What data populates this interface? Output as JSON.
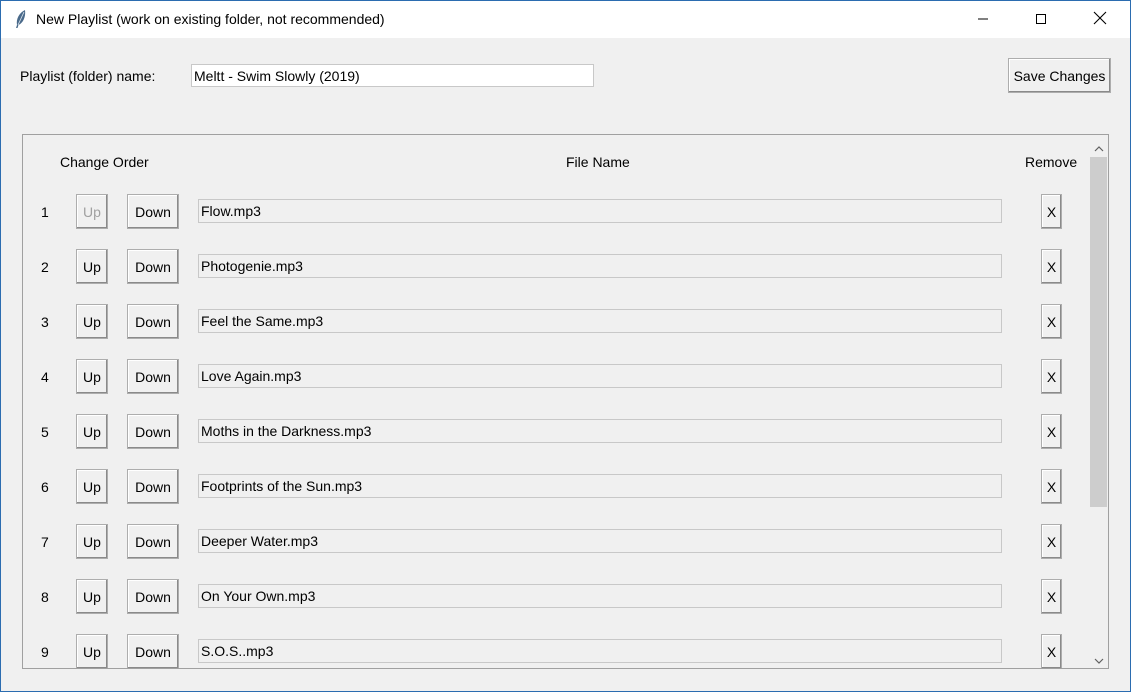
{
  "window": {
    "title": "New Playlist (work on existing folder, not recommended)",
    "icon": "feather-icon",
    "controls": [
      "minimize-icon",
      "maximize-icon",
      "close-icon"
    ]
  },
  "form": {
    "name_label": "Playlist (folder) name:",
    "name_value": "Meltt - Swim Slowly (2019)",
    "save_label": "Save Changes"
  },
  "list": {
    "headers": {
      "order": "Change Order",
      "file": "File Name",
      "remove": "Remove"
    },
    "up_label": "Up",
    "down_label": "Down",
    "remove_label": "X",
    "rows": [
      {
        "num": "1",
        "file": "Flow.mp3",
        "up_disabled": true
      },
      {
        "num": "2",
        "file": "Photogenie.mp3",
        "up_disabled": false
      },
      {
        "num": "3",
        "file": "Feel the Same.mp3",
        "up_disabled": false
      },
      {
        "num": "4",
        "file": "Love Again.mp3",
        "up_disabled": false
      },
      {
        "num": "5",
        "file": "Moths in the Darkness.mp3",
        "up_disabled": false
      },
      {
        "num": "6",
        "file": "Footprints of the Sun.mp3",
        "up_disabled": false
      },
      {
        "num": "7",
        "file": "Deeper Water.mp3",
        "up_disabled": false
      },
      {
        "num": "8",
        "file": "On Your Own.mp3",
        "up_disabled": false
      },
      {
        "num": "9",
        "file": "S.O.S..mp3",
        "up_disabled": false
      }
    ]
  },
  "colors": {
    "window_bg": "#f0f0f0",
    "titlebar_bg": "#ffffff",
    "window_border": "#2b6cb0",
    "disabled_text": "#a0a0a0"
  }
}
